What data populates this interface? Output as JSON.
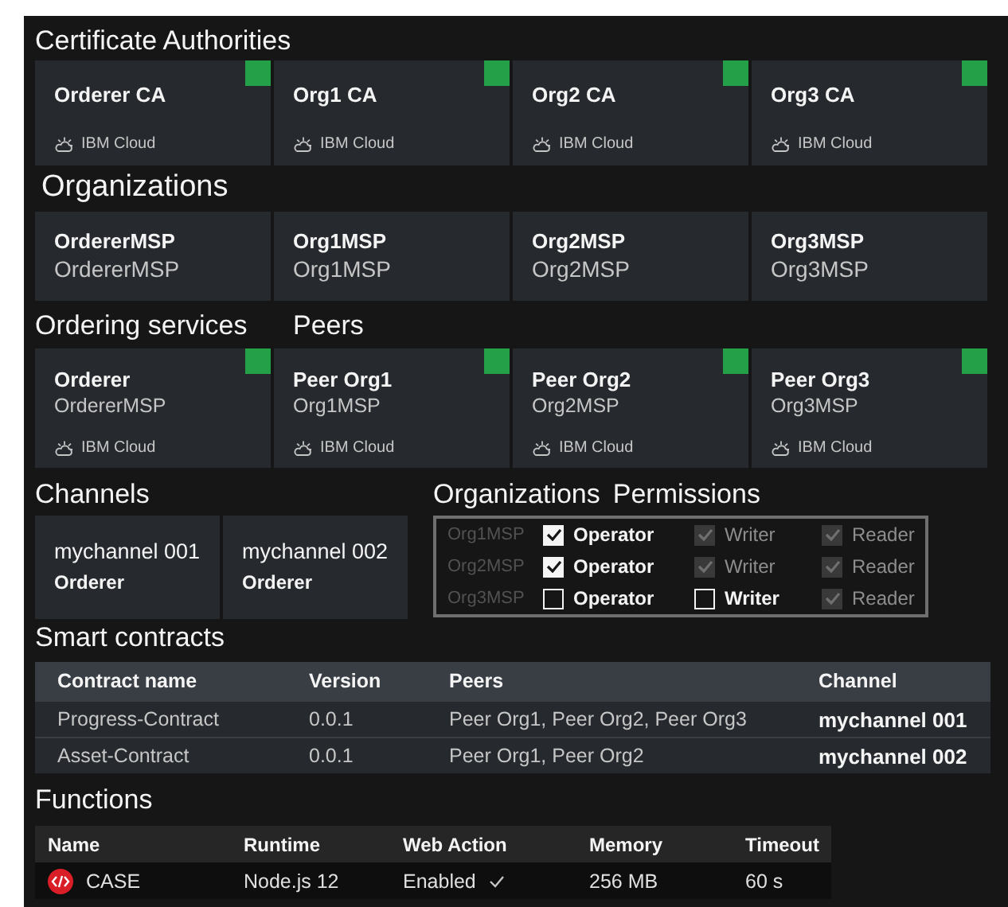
{
  "certificate_authorities": {
    "title": "Certificate Authorities",
    "cards": [
      {
        "name": "Orderer CA",
        "location": "IBM Cloud",
        "active": true
      },
      {
        "name": "Org1 CA",
        "location": "IBM Cloud",
        "active": true
      },
      {
        "name": "Org2 CA",
        "location": "IBM Cloud",
        "active": true
      },
      {
        "name": "Org3 CA",
        "location": "IBM Cloud",
        "active": true
      }
    ]
  },
  "organizations": {
    "title": "Organizations",
    "cards": [
      {
        "name": "OrdererMSP",
        "msp": "OrdererMSP"
      },
      {
        "name": "Org1MSP",
        "msp": "Org1MSP"
      },
      {
        "name": "Org2MSP",
        "msp": "Org2MSP"
      },
      {
        "name": "Org3MSP",
        "msp": "Org3MSP"
      }
    ]
  },
  "ordering_services": {
    "title": "Ordering services",
    "cards": [
      {
        "name": "Orderer",
        "msp": "OrdererMSP",
        "location": "IBM Cloud",
        "active": true
      }
    ]
  },
  "peers": {
    "title": "Peers",
    "cards": [
      {
        "name": "Peer Org1",
        "msp": "Org1MSP",
        "location": "IBM Cloud",
        "active": true
      },
      {
        "name": "Peer Org2",
        "msp": "Org2MSP",
        "location": "IBM Cloud",
        "active": true
      },
      {
        "name": "Peer Org3",
        "msp": "Org3MSP",
        "location": "IBM Cloud",
        "active": true
      }
    ]
  },
  "channels": {
    "title": "Channels",
    "cards": [
      {
        "name": "mychannel 001",
        "orderer": "Orderer"
      },
      {
        "name": "mychannel 002",
        "orderer": "Orderer"
      }
    ]
  },
  "permissions": {
    "title_1": "Organizations",
    "title_2": "Permissions",
    "rows": [
      {
        "org": "Org1MSP",
        "options": [
          {
            "label": "Operator",
            "checked": true,
            "disabled": false
          },
          {
            "label": "Writer",
            "checked": true,
            "disabled": true
          },
          {
            "label": "Reader",
            "checked": true,
            "disabled": true
          }
        ]
      },
      {
        "org": "Org2MSP",
        "options": [
          {
            "label": "Operator",
            "checked": true,
            "disabled": false
          },
          {
            "label": "Writer",
            "checked": true,
            "disabled": true
          },
          {
            "label": "Reader",
            "checked": true,
            "disabled": true
          }
        ]
      },
      {
        "org": "Org3MSP",
        "options": [
          {
            "label": "Operator",
            "checked": false,
            "disabled": false
          },
          {
            "label": "Writer",
            "checked": false,
            "disabled": false
          },
          {
            "label": "Reader",
            "checked": true,
            "disabled": true
          }
        ]
      }
    ]
  },
  "smart_contracts": {
    "title": "Smart contracts",
    "columns": [
      "Contract name",
      "Version",
      "Peers",
      "Channel"
    ],
    "rows": [
      [
        "Progress-Contract",
        "0.0.1",
        "Peer Org1, Peer Org2, Peer Org3",
        "mychannel 001"
      ],
      [
        "Asset-Contract",
        "0.0.1",
        "Peer Org1, Peer Org2",
        "mychannel 002"
      ]
    ]
  },
  "functions": {
    "title": "Functions",
    "columns": [
      "Name",
      "Runtime",
      "Web Action",
      "Memory",
      "Timeout"
    ],
    "rows": [
      {
        "name": "CASE",
        "runtime": "Node.js 12",
        "web_action": "Enabled",
        "memory": "256 MB",
        "timeout": "60 s"
      }
    ]
  }
}
